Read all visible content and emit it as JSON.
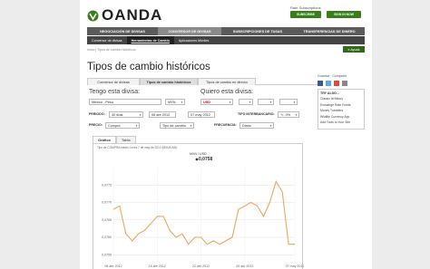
{
  "brand": {
    "name": "OANDA",
    "accent": "#3a7d1d"
  },
  "header": {
    "registration": "Rate Subscriptions",
    "subscribe_label": "SUBSCRIBE",
    "login_label": "SIGN IN NOW"
  },
  "nav_primary": [
    "NEGOCIACIÓN DE DIVISAS",
    "CONVERSOR DE DIVISAS",
    "SUBSCRIPCIONES DE TASAS",
    "TRANSFERENCIAS DE DINERO"
  ],
  "nav_secondary": [
    "Conversor de divisas",
    "Herramientas de Cambio",
    "Aplicaciones Móviles"
  ],
  "breadcrumb": "Inicio | Tipos de cambio históricos",
  "help_label": "e Ayuda",
  "page_title": "Tipos de cambio históricos",
  "tabs": [
    "Conversor de divisas",
    "Tipos de cambio históricos",
    "Tipos de cambio en directo"
  ],
  "share": {
    "save": "Guardar",
    "share": "Compartir"
  },
  "form": {
    "have_label": "Tengo esta divisa:",
    "want_label": "Quiero esta divisa:",
    "have_currency": "México - Peso",
    "have_code": "MXN",
    "want_code": "USD",
    "period_label": "PERIODO:",
    "period_value": "30 días",
    "start_date": "08 abr 2012",
    "end_date": "07 may 2012",
    "interbank_label": "TIPO INTERBANCARIO:",
    "interbank_value": "+/- 0%",
    "price_label": "PRECIO:",
    "price_value": "Compra",
    "type_value": "Tipo de cambio",
    "frequency_label": "FRECUENCIA:",
    "frequency_value": "Diario"
  },
  "subtabs": [
    "Gráfico",
    "Tabla"
  ],
  "chart_info": {
    "legend": "Tipo de COMPRA medio: lunes 7 de may de 2012 (MXN/USD)",
    "point_pair": "MXN / USD",
    "point_value": "0,0758"
  },
  "sidebar": {
    "try_title": "TRY ALSO...",
    "items": [
      "Classic fxHistory",
      "Exchange Rate Feeds",
      "Money Transfers",
      "Wildlife Currency App",
      "Add Tools to Your Site"
    ]
  },
  "chart_data": {
    "type": "line",
    "x_labels": [
      "08 abr 2012",
      "15 abr 2012",
      "22 abr 2012",
      "29 abr 2012",
      "07 may 2012"
    ],
    "y_ticks": [
      0.0775,
      0.077,
      0.0765,
      0.076,
      0.0755
    ],
    "ylim": [
      0.0753,
      0.078
    ],
    "series": [
      {
        "values": [
          0.0768,
          0.0769,
          0.0761,
          0.0759,
          0.0761,
          0.0762,
          0.0764,
          0.0766,
          0.0766,
          0.0762,
          0.076,
          0.0761,
          0.0758,
          0.076,
          0.076,
          0.0758,
          0.0759,
          0.0758,
          0.0759,
          0.076,
          0.0768,
          0.0769,
          0.077,
          0.0769,
          0.0766,
          0.077,
          0.0776,
          0.0773,
          0.0758,
          0.0758
        ],
        "color": "#f0a45c"
      }
    ],
    "grid": true
  }
}
